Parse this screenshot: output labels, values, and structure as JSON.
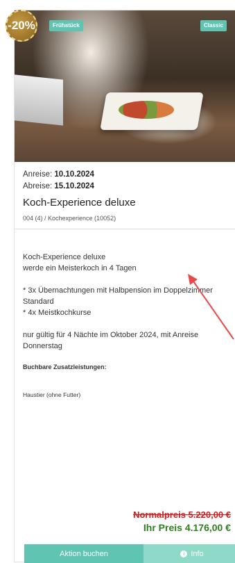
{
  "card": {
    "discount_badge": "-20%",
    "tag_left": "Frühstück",
    "tag_right": "Classic",
    "arrival_label": "Anreise:",
    "arrival_date": "10.10.2024",
    "departure_label": "Abreise:",
    "departure_date": "15.10.2024",
    "title": "Koch-Experience deluxe",
    "code": "004 (4) / Kochexperience (10052)",
    "description": "Koch-Experience deluxe\nwerde ein Meisterkoch in 4 Tagen\n\n* 3x Übernachtungen mit Halbpension im Doppelzimmer Standard\n* 4x Meistkochkurse\n\nnur gültig für 4 Nächte im Oktober 2024, mit Anreise Donnerstag",
    "extras_title": "Buchbare Zusatzleistungen:",
    "extras_item": "Haustier (ohne Futter)",
    "old_price": "Normalpreis 5.220,00 €",
    "new_price": "Ihr Preis 4.176,00 €",
    "book_button": "Aktion buchen",
    "info_button": "Info"
  },
  "colors": {
    "accent": "#5fc5b2",
    "accent_light": "#8fd9c8",
    "old_price": "#d01c1c",
    "new_price": "#2e7d1e",
    "annotation_arrow": "#e84a4a"
  },
  "icons": {
    "info": "info-circle-icon"
  }
}
